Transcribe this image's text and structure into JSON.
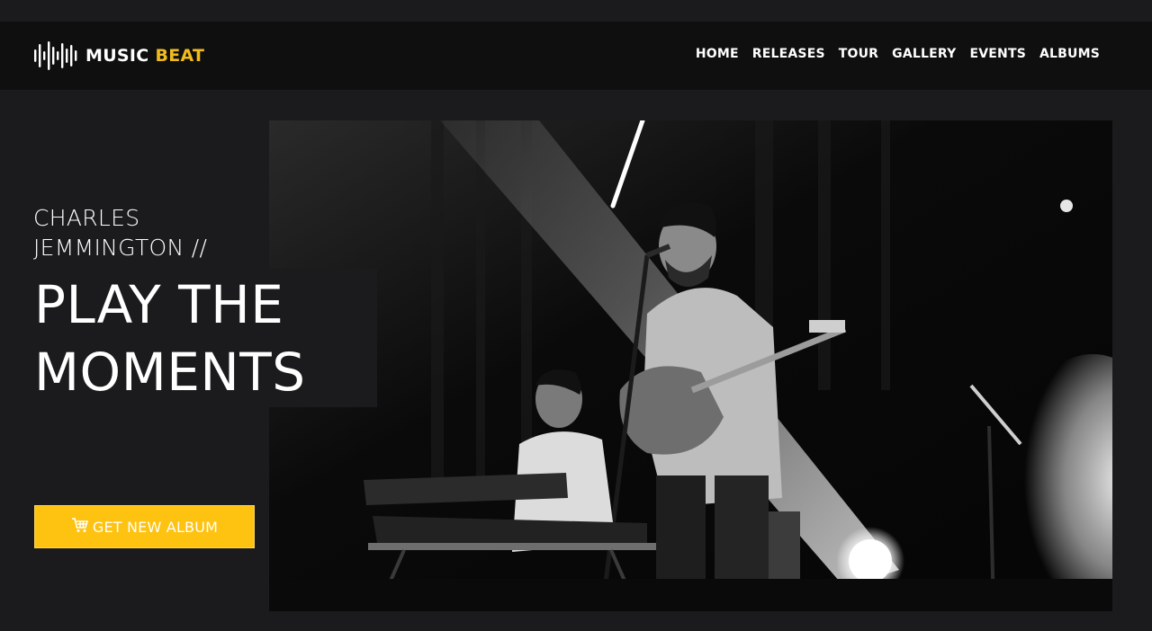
{
  "brand": {
    "name_main": "MUSIC",
    "name_accent": "BEAT",
    "logo_icon": "sound-wave-icon",
    "accent_color": "#f2bb1c"
  },
  "nav": {
    "items": [
      {
        "label": "HOME"
      },
      {
        "label": "RELEASES"
      },
      {
        "label": "TOUR"
      },
      {
        "label": "GALLERY"
      },
      {
        "label": "EVENTS"
      },
      {
        "label": "ALBUMS"
      }
    ]
  },
  "hero": {
    "artist_line1": "CHARLES",
    "artist_line2": "JEMMINGTON //",
    "headline_line1": "PLAY THE",
    "headline_line2": "MOMENTS",
    "cta": {
      "label": "GET NEW ALBUM",
      "icon": "shopping-cart-icon",
      "color": "#fec210"
    },
    "photo": "black-and-white concert photo"
  },
  "colors": {
    "background": "#1b1b1d",
    "navbar": "#0f0f10"
  }
}
